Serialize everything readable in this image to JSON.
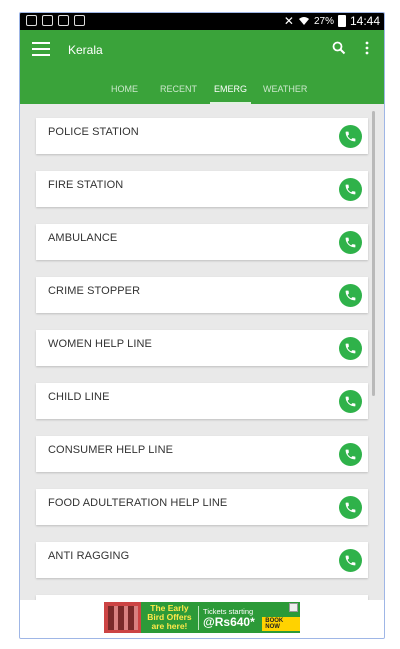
{
  "status_bar": {
    "battery_pct": "27%",
    "time": "14:44"
  },
  "app_bar": {
    "title": "Kerala"
  },
  "tabs": [
    {
      "label": "HOME"
    },
    {
      "label": "RECENT"
    },
    {
      "label": "EMERG"
    },
    {
      "label": "WEATHER"
    }
  ],
  "active_tab": "EMERG",
  "emergency_items": [
    {
      "label": "POLICE STATION"
    },
    {
      "label": "FIRE STATION"
    },
    {
      "label": "AMBULANCE"
    },
    {
      "label": "CRIME STOPPER"
    },
    {
      "label": "WOMEN HELP LINE"
    },
    {
      "label": "CHILD LINE"
    },
    {
      "label": "CONSUMER HELP LINE"
    },
    {
      "label": "FOOD ADULTERATION HELP LINE"
    },
    {
      "label": "ANTI RAGGING"
    }
  ],
  "ad": {
    "headline": "The Early Bird Offers are here!",
    "offer_line": "Tickets starting",
    "price": "@Rs640*",
    "cta": "BOOK NOW"
  },
  "colors": {
    "app_bar": "#3aa33a",
    "call_button": "#2fb24a",
    "list_bg": "#e9e9e9"
  },
  "icons": [
    "menu-icon",
    "search-icon",
    "more-vert-icon",
    "phone-icon"
  ]
}
